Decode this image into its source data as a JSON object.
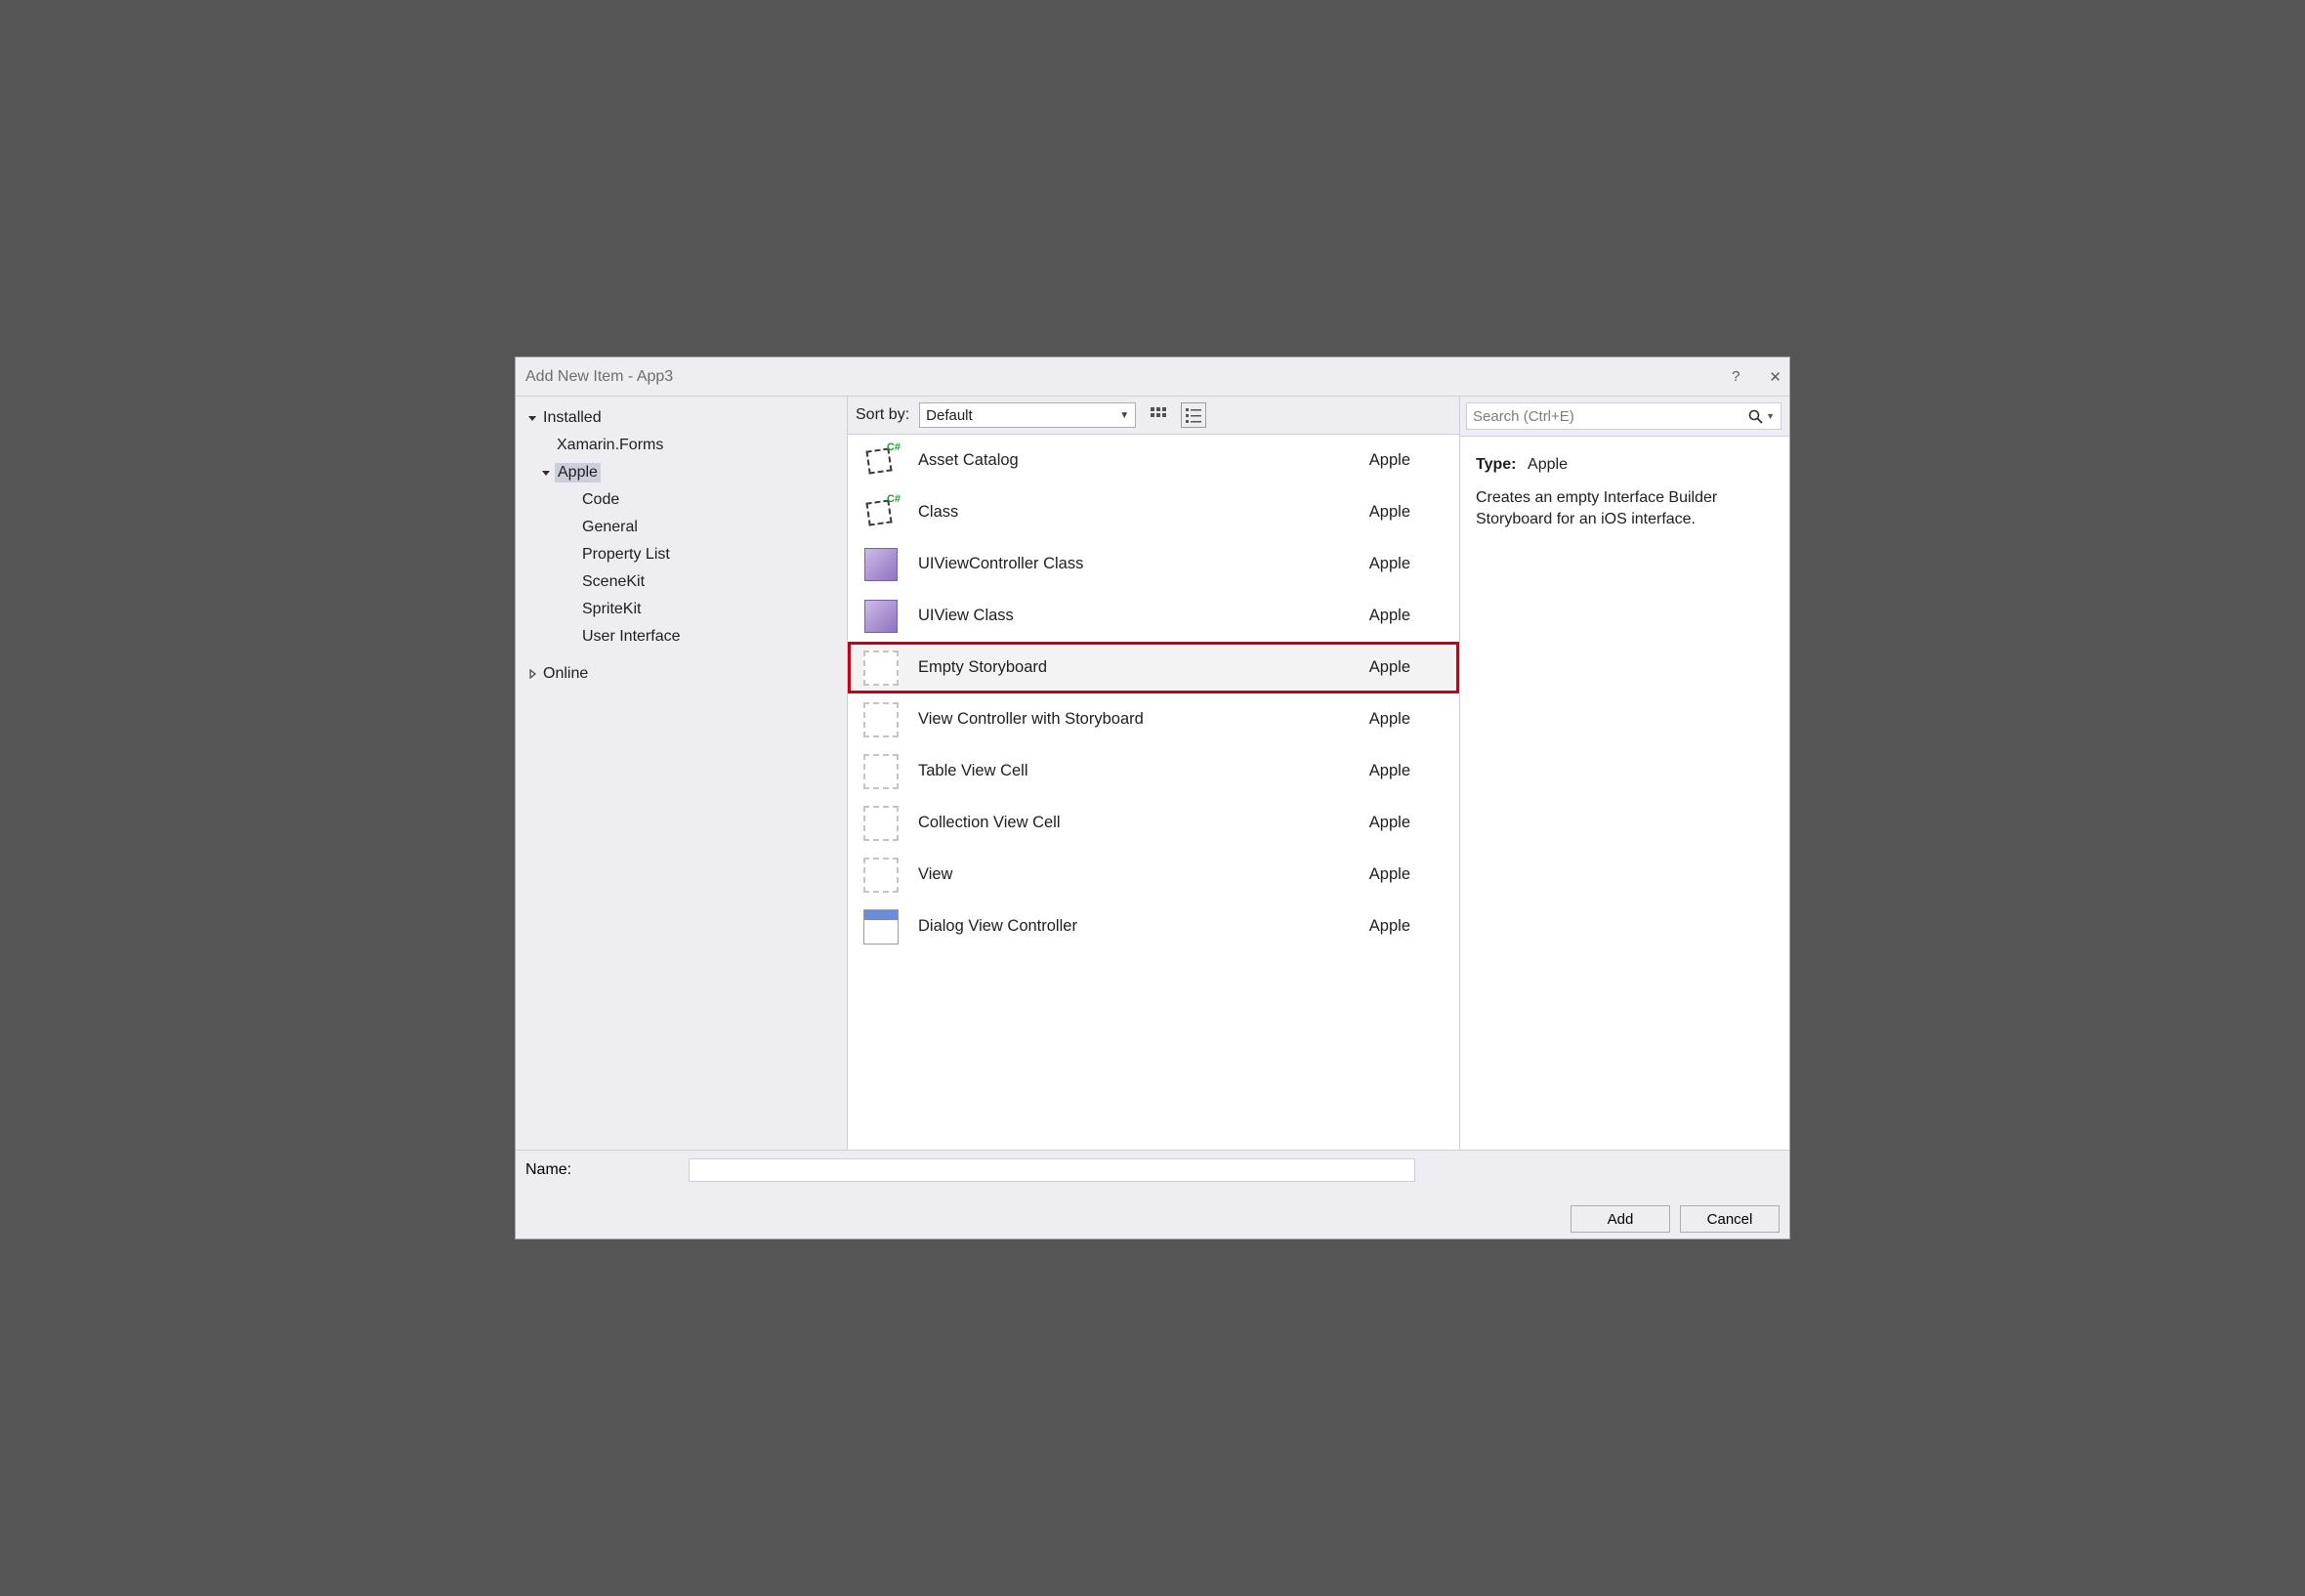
{
  "window": {
    "title": "Add New Item - App3"
  },
  "titlebar": {
    "help": "?",
    "close": "✕"
  },
  "sidebar": {
    "installed": "Installed",
    "items": {
      "xamarin_forms": "Xamarin.Forms",
      "apple": "Apple",
      "code": "Code",
      "general": "General",
      "property_list": "Property List",
      "scenekit": "SceneKit",
      "spritekit": "SpriteKit",
      "user_interface": "User Interface"
    },
    "online": "Online"
  },
  "sort": {
    "label": "Sort by:",
    "value": "Default"
  },
  "views": {
    "tiles": "tiles",
    "list": "list"
  },
  "templates": [
    {
      "name": "Asset Catalog",
      "category": "Apple",
      "icon": "code"
    },
    {
      "name": "Class",
      "category": "Apple",
      "icon": "code"
    },
    {
      "name": "UIViewController Class",
      "category": "Apple",
      "icon": "cube"
    },
    {
      "name": "UIView Class",
      "category": "Apple",
      "icon": "cube"
    },
    {
      "name": "Empty Storyboard",
      "category": "Apple",
      "icon": "sb",
      "selected": true
    },
    {
      "name": "View Controller with Storyboard",
      "category": "Apple",
      "icon": "sb"
    },
    {
      "name": "Table View Cell",
      "category": "Apple",
      "icon": "sb"
    },
    {
      "name": "Collection View Cell",
      "category": "Apple",
      "icon": "sb"
    },
    {
      "name": "View",
      "category": "Apple",
      "icon": "sb"
    },
    {
      "name": "Dialog View Controller",
      "category": "Apple",
      "icon": "dialog"
    }
  ],
  "search": {
    "placeholder": "Search (Ctrl+E)"
  },
  "details": {
    "type_label": "Type:",
    "type_value": "Apple",
    "description": "Creates an empty Interface Builder Storyboard for an iOS interface."
  },
  "footer": {
    "name_label": "Name:",
    "name_value": "",
    "add": "Add",
    "cancel": "Cancel"
  },
  "highlight_color": "#c40017"
}
